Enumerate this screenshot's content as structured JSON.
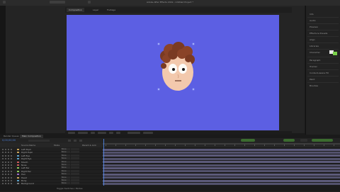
{
  "titlebar": {
    "title": "Adobe After Effects 2019 - Untitled Project *"
  },
  "composition": {
    "tabs": [
      "Composition",
      "Layer",
      "Footage"
    ],
    "zoom": "Full",
    "time": "0;00;00;00"
  },
  "right_panel": {
    "items": [
      "Info",
      "Audio",
      "Preview",
      "Effects & Presets",
      "Align",
      "Libraries",
      "Character",
      "Paragraph",
      "Tracker",
      "Content-Aware Fill",
      "Paint",
      "Brushes"
    ]
  },
  "timeline": {
    "tabs": [
      "Render Queue",
      "Main Composition"
    ],
    "timecode": "0;00;00;00",
    "headers": {
      "source": "Source Name",
      "mode": "Mode",
      "parent": "Parent & Link"
    },
    "layers": [
      {
        "name": "Left Pupil",
        "tag": "#c8a35a"
      },
      {
        "name": "Right Pupil",
        "tag": "#c8a35a"
      },
      {
        "name": "Left Eye",
        "tag": "#5aa0c8"
      },
      {
        "name": "Right Eye",
        "tag": "#5aa0c8"
      },
      {
        "name": "Mouth",
        "tag": "#c85a5a"
      },
      {
        "name": "Nose",
        "tag": "#c85a5a"
      },
      {
        "name": "Left Ear",
        "tag": "#8ac85a"
      },
      {
        "name": "Right Ear",
        "tag": "#8ac85a"
      },
      {
        "name": "Hair",
        "tag": "#9a6ac8"
      },
      {
        "name": "Head",
        "tag": "#c8a35a"
      },
      {
        "name": "Body",
        "tag": "#5aa0c8"
      },
      {
        "name": "Background",
        "tag": "#777777"
      }
    ],
    "parent_value": "None",
    "footer": "Toggle Switches / Modes"
  },
  "colors": {
    "canvas": "#5c5fe3",
    "playhead": "#4a7bd1",
    "track": "#5c5a7a"
  }
}
